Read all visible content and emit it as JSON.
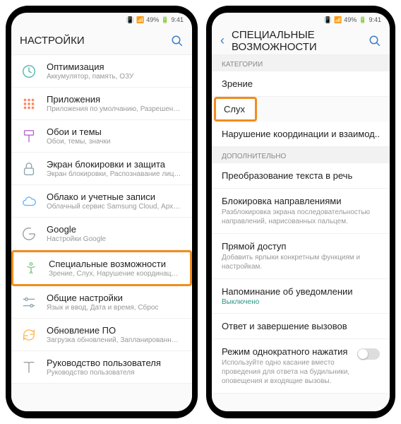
{
  "status": {
    "battery": "49%",
    "time": "9:41"
  },
  "left": {
    "title": "НАСТРОЙКИ",
    "items": [
      {
        "icon": "optimization",
        "color": "#4db6ac",
        "title": "Оптимизация",
        "sub": "Аккумулятор, память, ОЗУ"
      },
      {
        "icon": "apps",
        "color": "#ff8a65",
        "title": "Приложения",
        "sub": "Приложения по умолчанию, Разрешения..."
      },
      {
        "icon": "themes",
        "color": "#ba68c8",
        "title": "Обои и темы",
        "sub": "Обои, темы, значки"
      },
      {
        "icon": "lock",
        "color": "#90a4ae",
        "title": "Экран блокировки и защита",
        "sub": "Экран блокировки, Распознавание лица..."
      },
      {
        "icon": "cloud",
        "color": "#64b5f6",
        "title": "Облако и учетные записи",
        "sub": "Облачный сервис Samsung Cloud, Архив..."
      },
      {
        "icon": "google",
        "color": "#9e9e9e",
        "title": "Google",
        "sub": "Настройки Google"
      },
      {
        "icon": "accessibility",
        "color": "#81c784",
        "title": "Специальные возможности",
        "sub": "Зрение, Слух, Нарушение координации и..."
      },
      {
        "icon": "general",
        "color": "#90a4ae",
        "title": "Общие настройки",
        "sub": "Язык и ввод, Дата и время, Сброс"
      },
      {
        "icon": "update",
        "color": "#ffb74d",
        "title": "Обновление ПО",
        "sub": "Загрузка обновлений, Запланированное..."
      },
      {
        "icon": "manual",
        "color": "#9e9e9e",
        "title": "Руководство пользователя",
        "sub": "Руководство пользователя"
      }
    ],
    "highlighted_index": 6
  },
  "right": {
    "title": "СПЕЦИАЛЬНЫЕ ВОЗМОЖНОСТИ",
    "sections": [
      {
        "header": "КАТЕГОРИИ",
        "items": [
          {
            "title": "Зрение"
          },
          {
            "title": "Слух",
            "highlighted": true
          },
          {
            "title": "Нарушение координации и взаимод.."
          }
        ]
      },
      {
        "header": "ДОПОЛНИТЕЛЬНО",
        "items": [
          {
            "title": "Преобразование текста в речь"
          },
          {
            "title": "Блокировка направлениями",
            "sub": "Разблокировка экрана последовательностью направлений, нарисованных пальцем."
          },
          {
            "title": "Прямой доступ",
            "sub": "Добавить ярлыки конкретным функциям и настройкам."
          },
          {
            "title": "Напоминание об уведомлении",
            "status": "Выключено"
          },
          {
            "title": "Ответ и завершение вызовов"
          },
          {
            "title": "Режим однократного нажатия",
            "sub": "Используйте одно касание вместо проведения для ответа на будильники, оповещения и входящие вызовы.",
            "toggle": true
          }
        ]
      }
    ]
  }
}
